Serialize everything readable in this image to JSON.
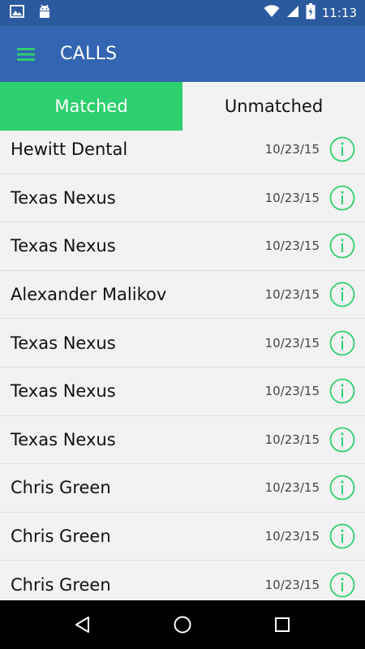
{
  "status_bar": {
    "time": "11:13",
    "icons": [
      "image-icon",
      "android-icon",
      "wifi-icon",
      "signal-icon",
      "battery-icon"
    ]
  },
  "app_bar": {
    "title": "CALLS",
    "menu_icon": "hamburger-menu-icon"
  },
  "tabs": [
    {
      "label": "Matched",
      "active": true
    },
    {
      "label": "Unmatched",
      "active": false
    }
  ],
  "calls": [
    {
      "name": "Hewitt Dental",
      "date": "10/23/15"
    },
    {
      "name": "Texas Nexus",
      "date": "10/23/15"
    },
    {
      "name": "Texas Nexus",
      "date": "10/23/15"
    },
    {
      "name": "Alexander Malikov",
      "date": "10/23/15"
    },
    {
      "name": "Texas Nexus",
      "date": "10/23/15"
    },
    {
      "name": "Texas Nexus",
      "date": "10/23/15"
    },
    {
      "name": "Texas Nexus",
      "date": "10/23/15"
    },
    {
      "name": "Chris Green",
      "date": "10/23/15"
    },
    {
      "name": "Chris Green",
      "date": "10/23/15"
    },
    {
      "name": "Chris Green",
      "date": "10/23/15"
    }
  ],
  "colors": {
    "status_bar": "#2b5a9e",
    "app_bar": "#3365b3",
    "accent_green": "#2ecf6e",
    "list_bg": "#f2f2f2",
    "nav_bar": "#000000"
  },
  "nav_bar": {
    "icons": [
      "back-icon",
      "home-icon",
      "recents-icon"
    ]
  }
}
